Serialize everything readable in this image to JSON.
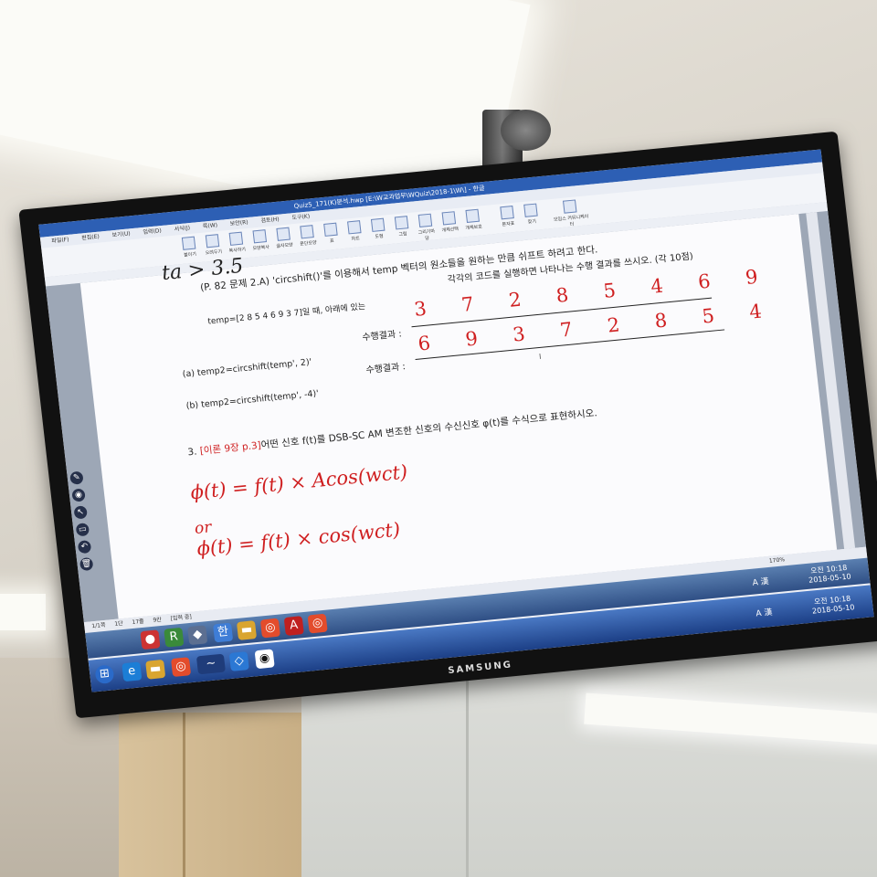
{
  "monitor": {
    "brand": "SAMSUNG"
  },
  "window": {
    "title": "Quiz5_171(K)분석.hwp [E:\\W교과업무\\WQuiz\\2018-1\\W\\] - 한글",
    "menu": [
      "파일(F)",
      "편집(E)",
      "보기(U)",
      "입력(D)",
      "서식(J)",
      "쪽(W)",
      "보안(R)",
      "검토(H)",
      "도구(K)"
    ],
    "ribbon": [
      "붙이기",
      "오려두기",
      "복사하기",
      "모양복사",
      "글자모양",
      "문단모양",
      "표",
      "차트",
      "도형",
      "그림",
      "그리기마당",
      "개체선택",
      "개체보호",
      "문자표",
      "찾기",
      "모임스 커뮤니케이터"
    ]
  },
  "document": {
    "question2_intro": "(P. 82 문제 2.A) 'circshift()'를 이용해서 temp 벡터의 원소들을 원하는 만큼 쉬프트 하려고 한다.",
    "question2_intro_2": "각각의 코드를 실행하면 나타나는 수행 결과를 쓰시오. (각 10점)",
    "temp_line": "temp=[2 8 5 4 6 9 3 7]일 때, 아래에 있는",
    "result_label": "수행결과 :",
    "item_a": "(a) temp2=circshift(temp', 2)'",
    "item_b": "(b) temp2=circshift(temp', -4)'",
    "answer_a": "3 7 2 8 5 4 6 9",
    "answer_b": "6 9 3 7 2 8 5 4",
    "question3_num": "3.",
    "question3_ref": "[이론 9장 p.3]",
    "question3_text": "어떤 신호 f(t)를 DSB-SC AM 변조한 신호의 수신신호 φ(t)를 수식으로 표현하시오.",
    "eq1": "ϕ(t) = f(t) × Acos(wct)",
    "eq_or": "or",
    "eq2": "ϕ(t) = f(t) × cos(wct)",
    "top_fragment": "ta > 3.5"
  },
  "statusbar": {
    "page": "1/1쪽",
    "section": "1단",
    "line": "17줄",
    "col": "9칸",
    "mode": "[입력 중]",
    "zoom": "170%"
  },
  "taskbar": {
    "time": "오전 10:18",
    "date": "2018-05-10",
    "ime": "A 漢"
  },
  "colors": {
    "accent": "#cf1f20",
    "taskbar": "#2f5aa8"
  }
}
